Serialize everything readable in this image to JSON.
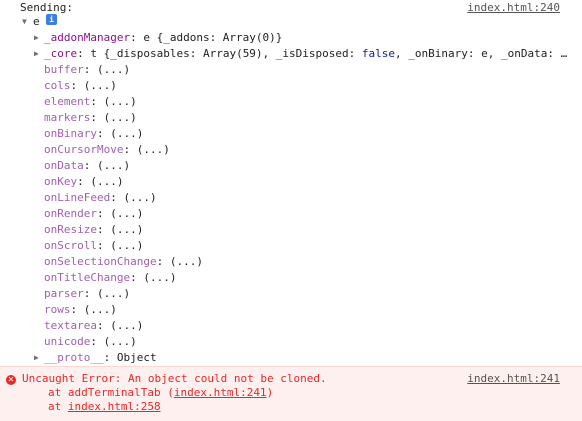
{
  "header": {
    "message": "Sending:",
    "source": "index.html:240"
  },
  "root": {
    "name": "e",
    "info_badge": "i"
  },
  "addon_manager": {
    "key": "_addonManager",
    "value": ": e {_addons: Array(0)}"
  },
  "core": {
    "key": "_core",
    "value_prefix": ": t {_disposables: Array(59), _isDisposed: ",
    "value_bool": "false",
    "value_suffix": ", _onBinary: e, _onData: …"
  },
  "properties": [
    {
      "key": "buffer",
      "value": ": (...)"
    },
    {
      "key": "cols",
      "value": ": (...)"
    },
    {
      "key": "element",
      "value": ": (...)"
    },
    {
      "key": "markers",
      "value": ": (...)"
    },
    {
      "key": "onBinary",
      "value": ": (...)"
    },
    {
      "key": "onCursorMove",
      "value": ": (...)"
    },
    {
      "key": "onData",
      "value": ": (...)"
    },
    {
      "key": "onKey",
      "value": ": (...)"
    },
    {
      "key": "onLineFeed",
      "value": ": (...)"
    },
    {
      "key": "onRender",
      "value": ": (...)"
    },
    {
      "key": "onResize",
      "value": ": (...)"
    },
    {
      "key": "onScroll",
      "value": ": (...)"
    },
    {
      "key": "onSelectionChange",
      "value": ": (...)"
    },
    {
      "key": "onTitleChange",
      "value": ": (...)"
    },
    {
      "key": "parser",
      "value": ": (...)"
    },
    {
      "key": "rows",
      "value": ": (...)"
    },
    {
      "key": "textarea",
      "value": ": (...)"
    },
    {
      "key": "unicode",
      "value": ": (...)"
    }
  ],
  "proto": {
    "key": "__proto__",
    "value": ": Object"
  },
  "error": {
    "message": "Uncaught Error: An object could not be cloned.",
    "source": "index.html:241",
    "stack": [
      {
        "prefix": "at addTerminalTab (",
        "link": "index.html:241",
        "suffix": ")"
      },
      {
        "prefix": "at ",
        "link": "index.html:258",
        "suffix": ""
      }
    ]
  },
  "colors": {
    "own_key": "#881391",
    "inherited_key": "#a05fb0",
    "error_text": "#e52929",
    "error_background": "#fff0f0",
    "boolean": "#0d22aa"
  }
}
